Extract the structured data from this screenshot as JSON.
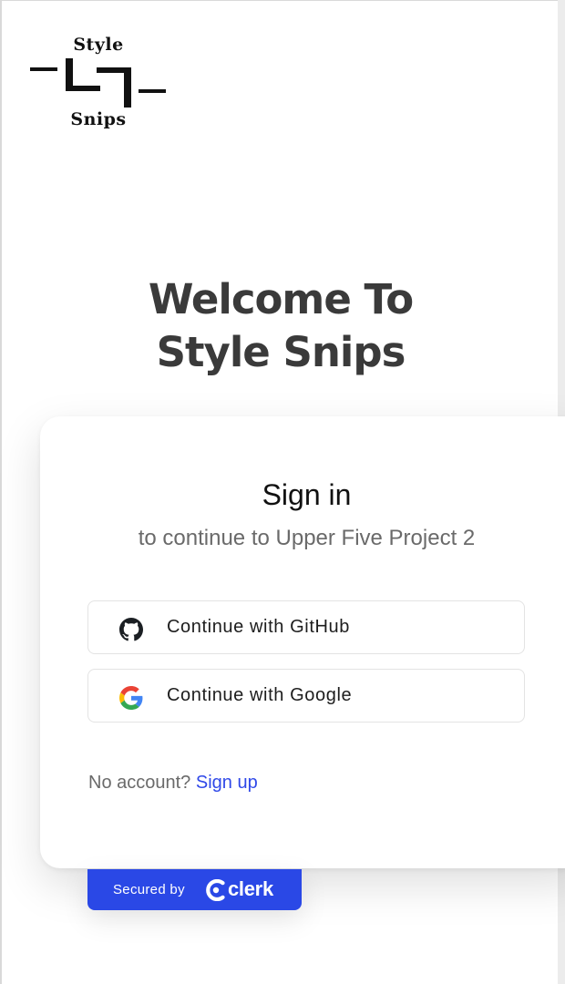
{
  "logo": {
    "top_text": "Style",
    "bottom_text": "Snips"
  },
  "welcome": {
    "line1": "Welcome To",
    "line2": "Style Snips"
  },
  "signin": {
    "title": "Sign in",
    "subtitle": "to continue to Upper Five Project 2",
    "buttons": [
      {
        "label": "Continue with GitHub",
        "icon": "github-icon"
      },
      {
        "label": "Continue with Google",
        "icon": "google-icon"
      }
    ],
    "no_account_text": "No account?",
    "signup_link": "Sign up"
  },
  "footer": {
    "secured_by": "Secured by",
    "brand": "clerk"
  },
  "colors": {
    "accent": "#2a48e6",
    "link": "#2f48e8",
    "heading": "#3a3a3a"
  }
}
